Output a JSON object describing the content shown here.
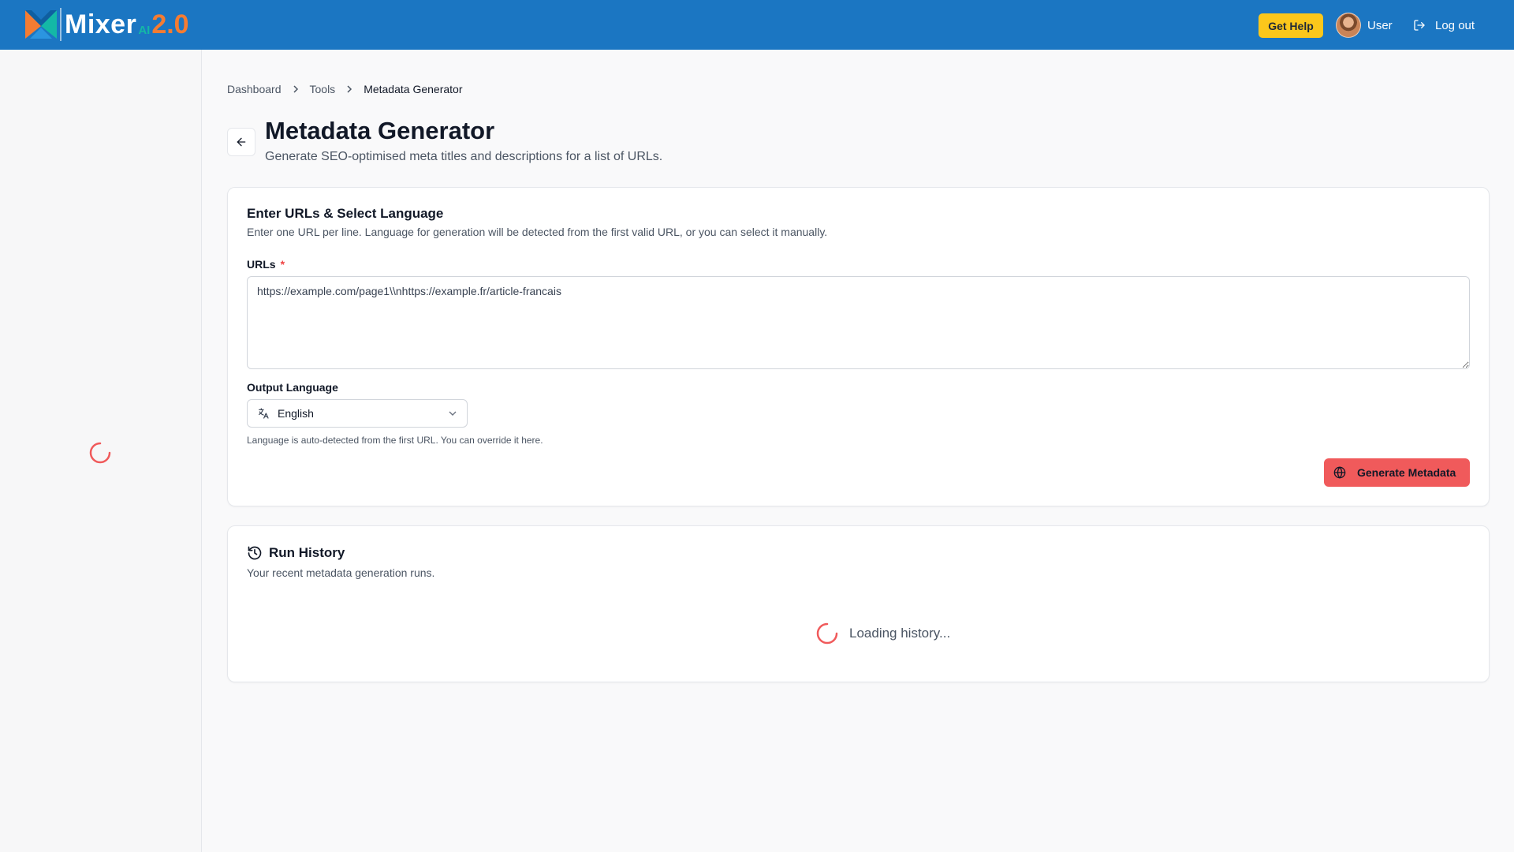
{
  "header": {
    "logo_text": "Mixer",
    "logo_ai": "AI",
    "logo_version": "2.0",
    "get_help_label": "Get Help",
    "user_label": "User",
    "logout_label": "Log out"
  },
  "breadcrumb": {
    "items": [
      "Dashboard",
      "Tools",
      "Metadata Generator"
    ]
  },
  "page": {
    "title": "Metadata Generator",
    "subtitle": "Generate SEO-optimised meta titles and descriptions for a list of URLs."
  },
  "input_card": {
    "title": "Enter URLs & Select Language",
    "description": "Enter one URL per line. Language for generation will be detected from the first valid URL, or you can select it manually.",
    "urls_label": "URLs",
    "required_marker": "*",
    "urls_value": "https://example.com/page1\\\\nhttps://example.fr/article-francais",
    "language_label": "Output Language",
    "language_value": "English",
    "language_help": "Language is auto-detected from the first URL. You can override it here.",
    "generate_label": "Generate Metadata"
  },
  "history_card": {
    "title": "Run History",
    "description": "Your recent metadata generation runs.",
    "loading_text": "Loading history..."
  },
  "colors": {
    "header_bg": "#1b76c2",
    "get_help_bg": "#fbc71b",
    "accent_red": "#f05a5b",
    "logo_version": "#f47c32",
    "logo_ai": "#14b8a6"
  },
  "icons": {
    "back": "arrow-left-icon",
    "language": "translate-icon",
    "generate": "globe-icon",
    "history": "history-icon",
    "logout": "logout-icon"
  }
}
